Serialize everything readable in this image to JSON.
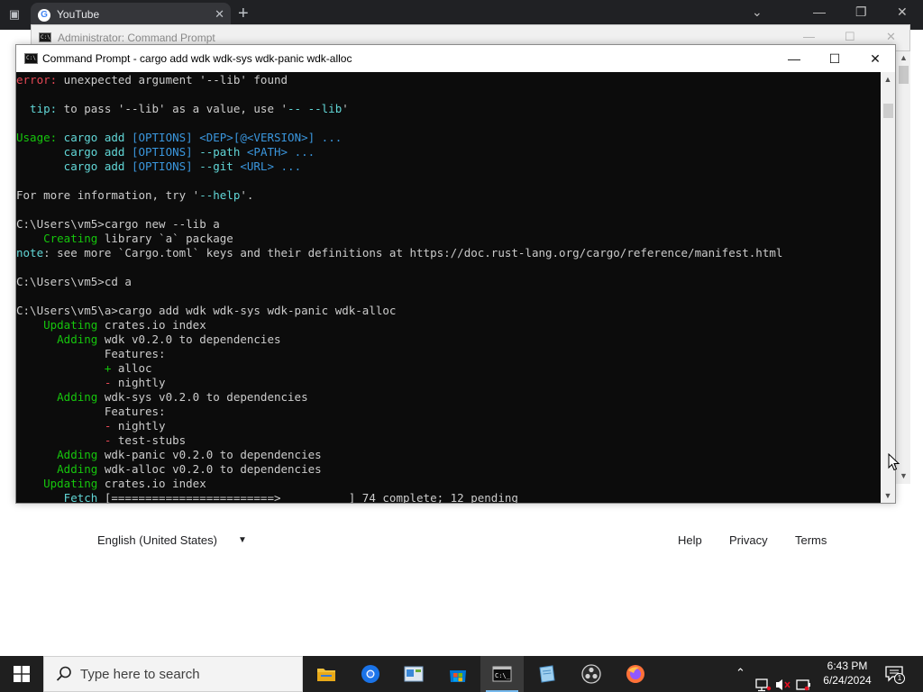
{
  "browser": {
    "tab_title": "YouTube",
    "tab_close": "✕",
    "new_tab": "+",
    "footer": {
      "language": "English (United States)",
      "links": [
        "Help",
        "Privacy",
        "Terms"
      ]
    }
  },
  "background_window": {
    "title": "Administrator: Command Prompt"
  },
  "cmd_window": {
    "title": "Command Prompt - cargo  add wdk wdk-sys wdk-panic wdk-alloc",
    "console_lines": [
      [
        {
          "t": "error:",
          "c": "red"
        },
        {
          "t": " unexpected argument '--lib' found",
          "c": "gray"
        }
      ],
      [],
      [
        {
          "t": "  tip:",
          "c": "cyan"
        },
        {
          "t": " to pass '--lib' as a value, use '",
          "c": "gray"
        },
        {
          "t": "-- --lib",
          "c": "cyan"
        },
        {
          "t": "'",
          "c": "gray"
        }
      ],
      [],
      [
        {
          "t": "Usage:",
          "c": "green"
        },
        {
          "t": " cargo add ",
          "c": "cyan"
        },
        {
          "t": "[OPTIONS] <DEP>[@<VERSION>] ...",
          "c": "teal"
        }
      ],
      [
        {
          "t": "       cargo add ",
          "c": "cyan"
        },
        {
          "t": "[OPTIONS] ",
          "c": "teal"
        },
        {
          "t": "--path ",
          "c": "cyan"
        },
        {
          "t": "<PATH> ...",
          "c": "teal"
        }
      ],
      [
        {
          "t": "       cargo add ",
          "c": "cyan"
        },
        {
          "t": "[OPTIONS] ",
          "c": "teal"
        },
        {
          "t": "--git ",
          "c": "cyan"
        },
        {
          "t": "<URL> ...",
          "c": "teal"
        }
      ],
      [],
      [
        {
          "t": "For more information, try '",
          "c": "gray"
        },
        {
          "t": "--help",
          "c": "cyan"
        },
        {
          "t": "'.",
          "c": "gray"
        }
      ],
      [],
      [
        {
          "t": "C:\\Users\\vm5>cargo new --lib a",
          "c": "gray"
        }
      ],
      [
        {
          "t": "    Creating",
          "c": "green"
        },
        {
          "t": " library `a` package",
          "c": "gray"
        }
      ],
      [
        {
          "t": "note",
          "c": "cyan"
        },
        {
          "t": ": see more `Cargo.toml` keys and their definitions at https://doc.rust-lang.org/cargo/reference/manifest.html",
          "c": "gray"
        }
      ],
      [],
      [
        {
          "t": "C:\\Users\\vm5>cd a",
          "c": "gray"
        }
      ],
      [],
      [
        {
          "t": "C:\\Users\\vm5\\a>cargo add wdk wdk-sys wdk-panic wdk-alloc",
          "c": "gray"
        }
      ],
      [
        {
          "t": "    Updating",
          "c": "green"
        },
        {
          "t": " crates.io index",
          "c": "gray"
        }
      ],
      [
        {
          "t": "      Adding",
          "c": "green"
        },
        {
          "t": " wdk v0.2.0 to dependencies",
          "c": "gray"
        }
      ],
      [
        {
          "t": "             Features:",
          "c": "gray"
        }
      ],
      [
        {
          "t": "             + ",
          "c": "green"
        },
        {
          "t": "alloc",
          "c": "gray"
        }
      ],
      [
        {
          "t": "             - ",
          "c": "red"
        },
        {
          "t": "nightly",
          "c": "gray"
        }
      ],
      [
        {
          "t": "      Adding",
          "c": "green"
        },
        {
          "t": " wdk-sys v0.2.0 to dependencies",
          "c": "gray"
        }
      ],
      [
        {
          "t": "             Features:",
          "c": "gray"
        }
      ],
      [
        {
          "t": "             - ",
          "c": "red"
        },
        {
          "t": "nightly",
          "c": "gray"
        }
      ],
      [
        {
          "t": "             - ",
          "c": "red"
        },
        {
          "t": "test-stubs",
          "c": "gray"
        }
      ],
      [
        {
          "t": "      Adding",
          "c": "green"
        },
        {
          "t": " wdk-panic v0.2.0 to dependencies",
          "c": "gray"
        }
      ],
      [
        {
          "t": "      Adding",
          "c": "green"
        },
        {
          "t": " wdk-alloc v0.2.0 to dependencies",
          "c": "gray"
        }
      ],
      [
        {
          "t": "    Updating",
          "c": "green"
        },
        {
          "t": " crates.io index",
          "c": "gray"
        }
      ],
      [
        {
          "t": "       Fetch",
          "c": "cyan"
        },
        {
          "t": " [========================>          ] 74 complete; 12 pending",
          "c": "gray"
        }
      ]
    ]
  },
  "taskbar": {
    "search_placeholder": "Type here to search",
    "apps": [
      "file-explorer",
      "chrome",
      "control-panel",
      "microsoft-store",
      "command-prompt",
      "notepad",
      "obs-studio",
      "firefox"
    ],
    "clock_time": "6:43 PM",
    "clock_date": "6/24/2024",
    "notification_count": "1"
  },
  "colors": {
    "console_bg": "#0c0c0c",
    "gray": "#cccccc",
    "red": "#e74856",
    "green": "#16c60c",
    "cyan": "#61d6d6",
    "teal": "#3a96dd",
    "taskbar": "#1f1f1f"
  }
}
